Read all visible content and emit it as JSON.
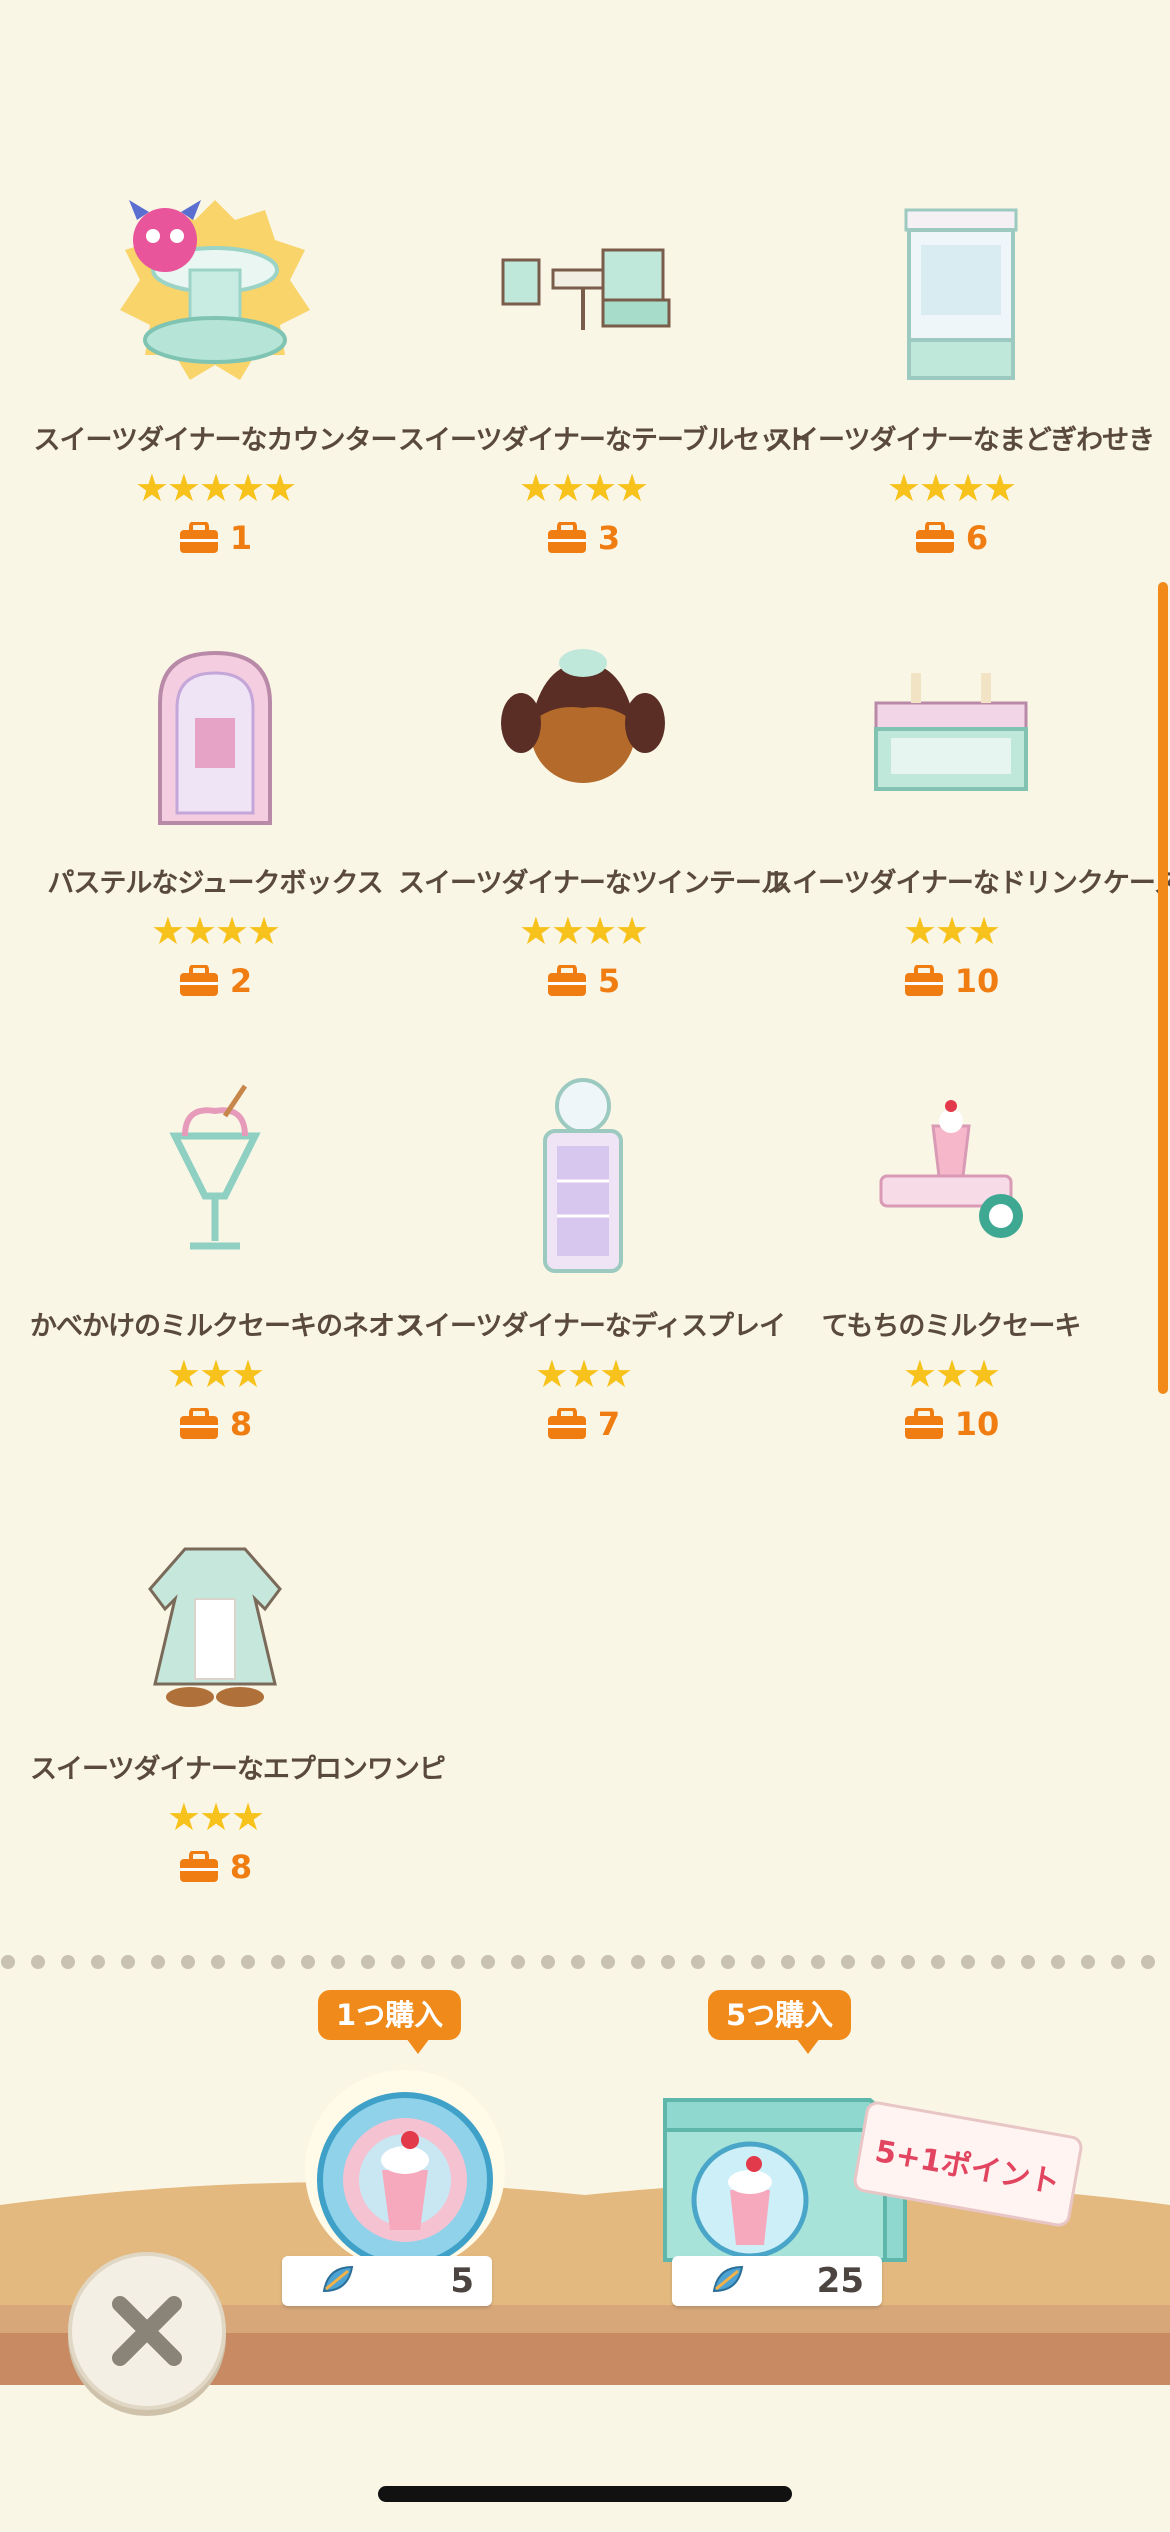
{
  "items": [
    {
      "name": "スイーツダイナーなカウンター",
      "stars": "★★★★★",
      "count": "1",
      "icon": "counter-icon"
    },
    {
      "name": "スイーツダイナーなテーブルセット",
      "stars": "★★★★",
      "count": "3",
      "icon": "table-set-icon"
    },
    {
      "name": "スイーツダイナーなまどぎわせき",
      "stars": "★★★★",
      "count": "6",
      "icon": "window-seat-icon"
    },
    {
      "name": "パステルなジュークボックス",
      "stars": "★★★★",
      "count": "2",
      "icon": "jukebox-icon"
    },
    {
      "name": "スイーツダイナーなツインテール",
      "stars": "★★★★",
      "count": "5",
      "icon": "twintail-hair-icon"
    },
    {
      "name": "スイーツダイナーなドリンクケース",
      "stars": "★★★",
      "count": "10",
      "icon": "drink-case-icon"
    },
    {
      "name": "かべかけのミルクセーキのネオン",
      "stars": "★★★",
      "count": "8",
      "icon": "milkshake-neon-icon"
    },
    {
      "name": "スイーツダイナーなディスプレイ",
      "stars": "★★★",
      "count": "7",
      "icon": "display-case-icon"
    },
    {
      "name": "てもちのミルクセーキ",
      "stars": "★★★",
      "count": "10",
      "icon": "handheld-milkshake-icon"
    },
    {
      "name": "スイーツダイナーなエプロンワンピ",
      "stars": "★★★",
      "count": "8",
      "icon": "apron-dress-icon"
    }
  ],
  "purchase": {
    "single": {
      "label": "1つ購入",
      "price": "5",
      "icon": "leaf-ticket-icon"
    },
    "bundle": {
      "label": "5つ購入",
      "price": "25",
      "bonus": "5+1ポイント",
      "icon": "leaf-ticket-icon"
    }
  },
  "colors": {
    "accent": "#f08a1a",
    "star": "#f7c21c",
    "background": "#faf6e6",
    "text": "#5a4a3e"
  }
}
